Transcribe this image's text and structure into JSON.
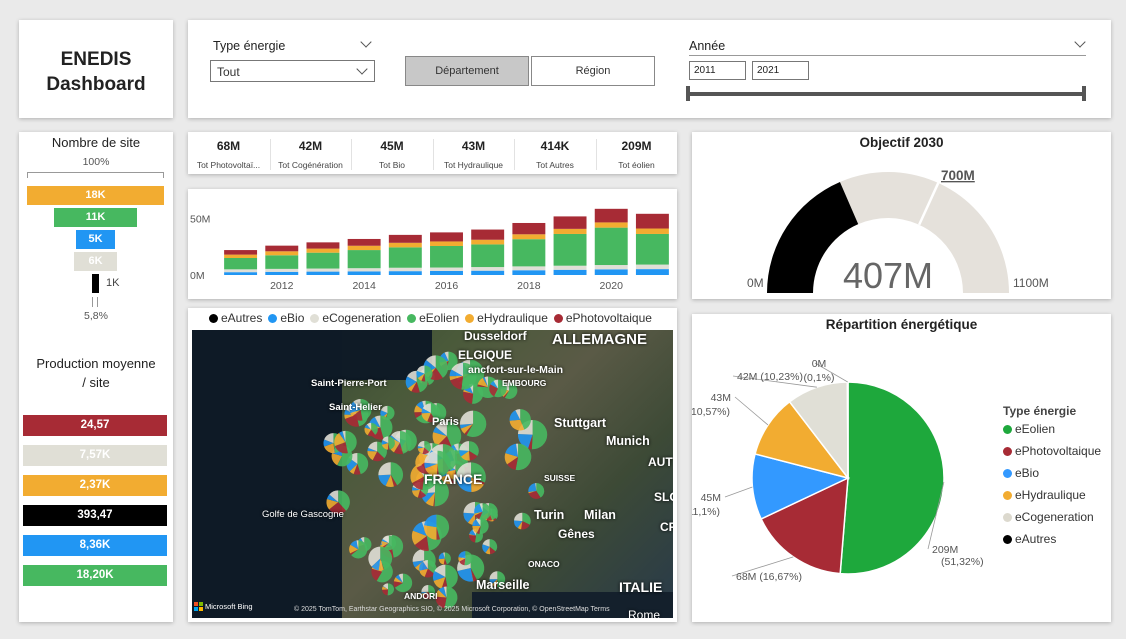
{
  "header": {
    "title_line1": "ENEDIS",
    "title_line2": "Dashboard"
  },
  "slicers": {
    "type_energie_label": "Type énergie",
    "type_energie_value": "Tout",
    "btn_departement": "Département",
    "btn_region": "Région",
    "annee_label": "Année",
    "year_start": "2011",
    "year_end": "2021"
  },
  "kpis": [
    {
      "value": "68M",
      "label": "Tot Photovoltaï..."
    },
    {
      "value": "42M",
      "label": "Tot Cogénération"
    },
    {
      "value": "45M",
      "label": "Tot Bio"
    },
    {
      "value": "43M",
      "label": "Tot Hydraulique"
    },
    {
      "value": "414K",
      "label": "Tot Autres"
    },
    {
      "value": "209M",
      "label": "Tot éolien"
    }
  ],
  "funnel": {
    "title": "Nombre de site",
    "top_pct": "100%",
    "bottom_pct": "5,8%",
    "bars": [
      {
        "label": "18K",
        "fraction": 1.0,
        "color": "#f2ac31"
      },
      {
        "label": "11K",
        "fraction": 0.61,
        "color": "#47b860"
      },
      {
        "label": "5K",
        "fraction": 0.28,
        "color": "#2196f3"
      },
      {
        "label": "6K",
        "fraction": 0.31,
        "color": "#e0dfd6"
      },
      {
        "label": "",
        "fraction": 0.055,
        "color": "#000000"
      }
    ],
    "last_label": "1K"
  },
  "production": {
    "title_line1": "Production moyenne",
    "title_line2": "/ site",
    "bars": [
      {
        "label": "24,57",
        "color": "#a72b35",
        "text_color": "#ffffff"
      },
      {
        "label": "7,57K",
        "color": "#e0dfd6",
        "text_color": "#ffffff"
      },
      {
        "label": "2,37K",
        "color": "#f2ac31",
        "text_color": "#ffffff"
      },
      {
        "label": "393,47",
        "color": "#000000",
        "text_color": "#ffffff"
      },
      {
        "label": "8,36K",
        "color": "#2196f3",
        "text_color": "#ffffff"
      },
      {
        "label": "18,20K",
        "color": "#47b860",
        "text_color": "#ffffff"
      }
    ]
  },
  "chart_data": [
    {
      "type": "bar",
      "stacked": true,
      "categories": [
        "2011",
        "2012",
        "2013",
        "2014",
        "2015",
        "2016",
        "2017",
        "2018",
        "2019",
        "2020",
        "2021"
      ],
      "x_tick_labels": [
        "2012",
        "2014",
        "2016",
        "2018",
        "2020"
      ],
      "y_tick_labels": [
        "50M",
        "0M"
      ],
      "ylim": [
        0,
        60
      ],
      "series": [
        {
          "name": "eBio",
          "color": "#2196f3",
          "values": [
            2.5,
            2.8,
            3.0,
            3.2,
            3.4,
            3.6,
            3.8,
            4.2,
            4.6,
            5.0,
            5.2
          ]
        },
        {
          "name": "eCogeneration",
          "color": "#e0dfd6",
          "values": [
            2.5,
            2.6,
            2.7,
            2.8,
            3.0,
            3.0,
            3.2,
            3.4,
            3.6,
            3.8,
            4.0
          ]
        },
        {
          "name": "eEolien",
          "color": "#47b860",
          "values": [
            10,
            12,
            14,
            16,
            18,
            19,
            20,
            24,
            28,
            33,
            27
          ]
        },
        {
          "name": "eHydraulique",
          "color": "#f2ac31",
          "values": [
            3.0,
            3.5,
            3.6,
            3.8,
            4.0,
            4.0,
            4.1,
            4.3,
            4.5,
            4.6,
            4.8
          ]
        },
        {
          "name": "ePhotovoltaique",
          "color": "#a72b35",
          "values": [
            4,
            5,
            5.5,
            6,
            7,
            8,
            9,
            10,
            11,
            12,
            13
          ]
        }
      ]
    },
    {
      "type": "gauge",
      "title": "Objectif 2030",
      "value": 407,
      "value_label": "407M",
      "min": 0,
      "min_label": "0M",
      "max": 1100,
      "max_label": "1100M",
      "target": 700,
      "target_label": "700M"
    },
    {
      "type": "pie",
      "title": "Répartition énergétique",
      "legend_title": "Type énergie",
      "slices": [
        {
          "name": "eEolien",
          "value": 209,
          "label": "209M",
          "pct": "(51,32%)",
          "color": "#1ea83c"
        },
        {
          "name": "ePhotovoltaique",
          "value": 68,
          "label": "68M (16,67%)",
          "pct": "",
          "color": "#a72b35"
        },
        {
          "name": "eBio",
          "value": 45,
          "label": "45M",
          "pct": "(11,1%)",
          "color": "#3399ff"
        },
        {
          "name": "eHydraulique",
          "value": 43,
          "label": "43M",
          "pct": "(10,57%)",
          "color": "#f2ac31"
        },
        {
          "name": "eCogeneration",
          "value": 42,
          "label": "42M (10,23%)",
          "pct": "",
          "color": "#e0dfd6"
        },
        {
          "name": "eAutres",
          "value": 0.414,
          "label": "0M",
          "pct": "(0,1%)",
          "color": "#000000"
        }
      ]
    }
  ],
  "map": {
    "legend": [
      "eAutres",
      "eBio",
      "eCogeneration",
      "eEolien",
      "eHydraulique",
      "ePhotovoltaique"
    ],
    "legend_colors": [
      "#000000",
      "#2196f3",
      "#e0dfd6",
      "#47b860",
      "#f2ac31",
      "#a72b35"
    ],
    "labels": {
      "dusseldorf": "Dusseldorf",
      "allemagne": "ALLEMAGNE",
      "belgique": "ELGIQUE",
      "frankfurt": "ancfort-sur-le-Main",
      "luxembourg": "EMBOURG",
      "saint_pierre": "Saint-Pierre-Port",
      "saint_helier": "Saint-Helier",
      "paris": "Paris",
      "stuttgart": "Stuttgart",
      "munich": "Munich",
      "aut1": "AUT",
      "france": "FRANCE",
      "suisse": "SUISSE",
      "slo": "SLO",
      "golfe": "Golfe de Gascogne",
      "turin": "Turin",
      "milan": "Milan",
      "genes": "Gênes",
      "cro": "CRO",
      "monaco": "ONACO",
      "marseille": "Marseille",
      "andorre": "ANDORI",
      "italie": "ITALIE",
      "rome": "Rome",
      "bing": "Microsoft Bing",
      "copyright": "© 2025 TomTom, Earthstar Geographics SIO, © 2025 Microsoft Corporation, © OpenStreetMap Terms"
    }
  }
}
